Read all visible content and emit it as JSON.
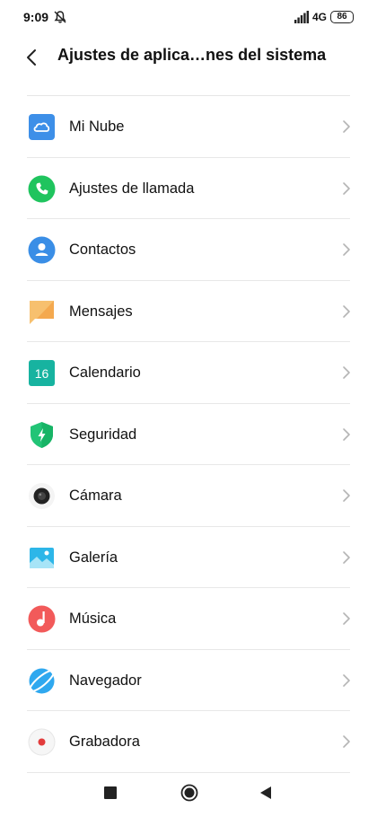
{
  "status": {
    "time": "9:09",
    "network": "4G",
    "battery": "86"
  },
  "header": {
    "title": "Ajustes de aplica…nes del sistema"
  },
  "items": [
    {
      "label": "Mi Nube",
      "icon": "cloud-icon",
      "color": "#3d8fe8"
    },
    {
      "label": "Ajustes de llamada",
      "icon": "phone-icon",
      "color": "#1fc45e"
    },
    {
      "label": "Contactos",
      "icon": "person-icon",
      "color": "#3a8ee6"
    },
    {
      "label": "Mensajes",
      "icon": "message-icon",
      "color": "#f7c06e"
    },
    {
      "label": "Calendario",
      "icon": "calendar-icon",
      "color": "#17b3a0",
      "icon_text": "16"
    },
    {
      "label": "Seguridad",
      "icon": "shield-icon",
      "color": "#22c476"
    },
    {
      "label": "Cámara",
      "icon": "camera-icon",
      "color": "#222222"
    },
    {
      "label": "Galería",
      "icon": "gallery-icon",
      "color": "#2db6e8"
    },
    {
      "label": "Música",
      "icon": "music-icon",
      "color": "#f25a5a"
    },
    {
      "label": "Navegador",
      "icon": "browser-icon",
      "color": "#2fa8ef"
    },
    {
      "label": "Grabadora",
      "icon": "recorder-icon",
      "color": "#e23b3b"
    }
  ]
}
